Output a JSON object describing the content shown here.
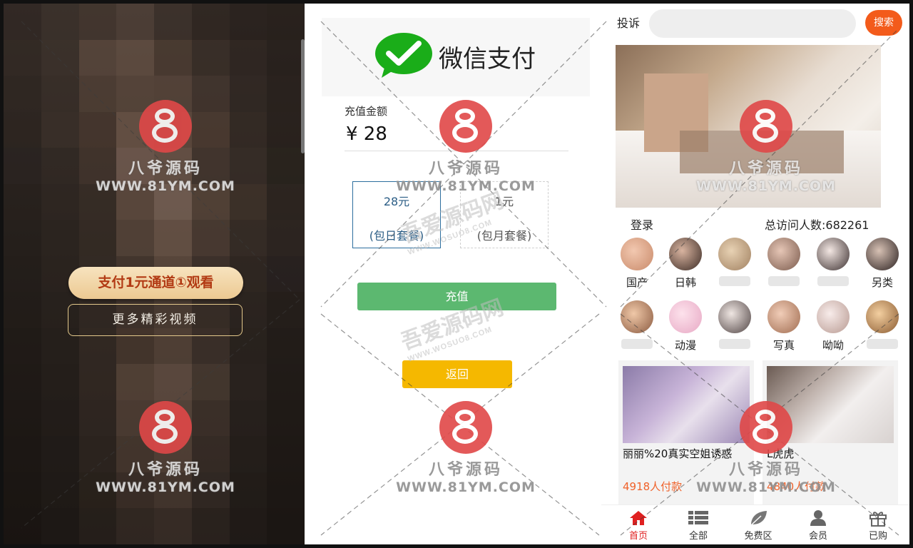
{
  "colors": {
    "accent_orange": "#f35b1b",
    "wechat_green": "#1aad19",
    "charge_green": "#5cb870",
    "back_yellow": "#f5b800",
    "active_red": "#e02020",
    "watermark_red": "#e04848"
  },
  "left": {
    "pay_button": "支付1元通道①观看",
    "more_button": "更多精彩视频"
  },
  "middle": {
    "wechat_pay_text": "微信支付",
    "amount_label": "充值金额",
    "amount_value": "¥ 28",
    "plans": [
      {
        "price": "28元",
        "name": "(包日套餐)",
        "selected": true
      },
      {
        "price": "1元",
        "name": "(包月套餐)",
        "selected": false
      }
    ],
    "charge_button": "充值",
    "back_button": "返回"
  },
  "right": {
    "report_label": "投诉",
    "search_placeholder": "",
    "search_button": "搜索",
    "login_label": "登录",
    "visits_label": "总访问人数:682261",
    "categories_row1": [
      {
        "label": "国产",
        "icon": "avatar-icon"
      },
      {
        "label": "日韩",
        "icon": "avatar-icon"
      },
      {
        "label": "",
        "icon": "avatar-icon"
      },
      {
        "label": "",
        "icon": "avatar-icon"
      },
      {
        "label": "",
        "icon": "avatar-icon"
      },
      {
        "label": "另类",
        "icon": "avatar-icon"
      }
    ],
    "categories_row2": [
      {
        "label": "",
        "icon": "avatar-icon"
      },
      {
        "label": "动漫",
        "icon": "avatar-icon"
      },
      {
        "label": "",
        "icon": "avatar-icon"
      },
      {
        "label": "写真",
        "icon": "avatar-icon"
      },
      {
        "label": "呦呦",
        "icon": "avatar-icon"
      },
      {
        "label": "",
        "icon": "avatar-icon"
      }
    ],
    "cards": [
      {
        "title": "丽丽%20真实空姐诱惑",
        "paid": "4918人付款"
      },
      {
        "title": "L虎虎",
        "paid": "4840人付款"
      }
    ],
    "tabs": [
      {
        "label": "首页",
        "icon": "home-icon",
        "active": true
      },
      {
        "label": "全部",
        "icon": "list-icon",
        "active": false
      },
      {
        "label": "免费区",
        "icon": "leaf-icon",
        "active": false
      },
      {
        "label": "会员",
        "icon": "user-icon",
        "active": false
      },
      {
        "label": "已购",
        "icon": "gift-icon",
        "active": false
      }
    ]
  },
  "watermark": {
    "brand": "八爷源码",
    "url": "WWW.81YM.COM",
    "secondary_brand": "吾爱源码网",
    "secondary_url": "WWW.WOSUO8.COM"
  }
}
